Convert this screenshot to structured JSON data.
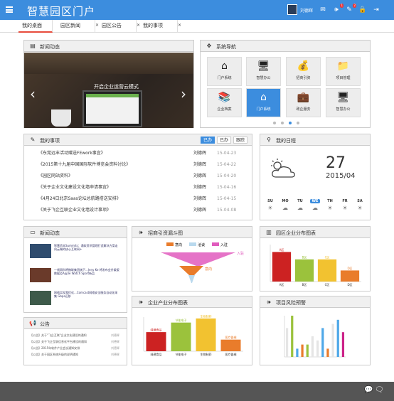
{
  "app": {
    "title": "智慧园区门户",
    "user": "刘德辉"
  },
  "tabs": [
    {
      "label": "我的桌面"
    },
    {
      "label": "园区新闻"
    },
    {
      "label": "园区公告"
    },
    {
      "label": "我的事项"
    }
  ],
  "news_panel": {
    "title": "新闻动态",
    "slide_caption": "开启企业运营云模式"
  },
  "nav_panel": {
    "title": "系统导航",
    "tiles": [
      {
        "label": "门户系统"
      },
      {
        "label": "智慧办公"
      },
      {
        "label": "招商引资"
      },
      {
        "label": "项目管理"
      },
      {
        "label": "企业档案"
      },
      {
        "label": "门户系统"
      },
      {
        "label": "政企服务"
      },
      {
        "label": "智慧办公"
      }
    ]
  },
  "todo_panel": {
    "title": "我的事项",
    "buttons": [
      "已办",
      "已办",
      "跟踪"
    ],
    "rows": [
      {
        "title": "《东莞远丰活动赠送FEwork事宜》",
        "who": "刘德辉",
        "date": "15-04-23"
      },
      {
        "title": "《2015第十九届中国国际软件博览会资料讨论》",
        "who": "刘德辉",
        "date": "15-04-22"
      },
      {
        "title": "《园区网站资料》",
        "who": "刘德辉",
        "date": "15-04-20"
      },
      {
        "title": "《关于企业文化建设文化墙申请事宜》",
        "who": "刘德辉",
        "date": "15-04-16"
      },
      {
        "title": "《4月24日北京Saas论坛总航路搭送安排》",
        "who": "刘德辉",
        "date": "15-04-15"
      },
      {
        "title": "《关于飞企互联企业文化墙设计事项》",
        "who": "刘德辉",
        "date": "15-04-08"
      }
    ]
  },
  "schedule_panel": {
    "title": "我的日程",
    "day": "27",
    "month": "2015/04",
    "week": [
      "SU",
      "MO",
      "TU",
      "WE",
      "TH",
      "FR",
      "SA"
    ]
  },
  "small_news": {
    "title": "新闻动态",
    "items": [
      {
        "text": "智慧资本Summits：通软资讯管理打造解决方案走向云端的核心互联网+"
      },
      {
        "text": "一线网科将携联集团旗下...Jeny Ke 将发布会升级版数据及Apple Watch Sport新品"
      },
      {
        "text": "网络实现我们化...Comcast网络安全服务自动化采集 Gbps迁移"
      }
    ]
  },
  "notice": {
    "title": "公告",
    "rows": [
      {
        "text": "【公告】关于\"飞企互联\"企业文化建设的通知",
        "date": "刘德辉"
      },
      {
        "text": "【公告】关于飞企互联信息化平台建设的通知",
        "date": "刘德辉"
      },
      {
        "text": "【公告】2015年软件产业会议通知安排",
        "date": "刘德辉"
      },
      {
        "text": "【公告】关于园区系统升级的说明通知",
        "date": "刘德辉"
      }
    ]
  },
  "funnel_panel": {
    "title": "招商引资漏斗图"
  },
  "enterprise_panel": {
    "title": "园区企业分布图表"
  },
  "industry_panel": {
    "title": "企业产业分布图表"
  },
  "risk_panel": {
    "title": "项目风险预警"
  },
  "colors": {
    "primary": "#3c8dde",
    "accent": "#e74c3c"
  },
  "chart_data": [
    {
      "type": "funnel",
      "series": [
        {
          "name": "意向",
          "value": 100
        },
        {
          "name": "洽谈",
          "value": 60
        },
        {
          "name": "入驻",
          "value": 20
        }
      ],
      "labels": [
        "入驻",
        "意向"
      ]
    },
    {
      "type": "bar",
      "categories": [
        "A区",
        "B区",
        "C区",
        "D区"
      ],
      "values": [
        4,
        3,
        3,
        1.5
      ],
      "data_labels": [
        "A区",
        "B区",
        "C区",
        "D区"
      ],
      "colors": [
        "#cc2222",
        "#9bc23c",
        "#f2c230",
        "#e97c2b"
      ],
      "ylim": [
        0,
        5
      ]
    },
    {
      "type": "bar",
      "categories": [
        "绿建食品",
        "节能电子",
        "生物制药",
        "医疗器械"
      ],
      "values": [
        2.8,
        4.2,
        4.8,
        1.7
      ],
      "data_labels": [
        "绿建食品",
        "节能电子",
        "生物制药",
        "医疗器械"
      ],
      "colors": [
        "#cc2222",
        "#9bc23c",
        "#f2c230",
        "#e97c2b"
      ],
      "ylim": [
        0,
        5
      ]
    },
    {
      "type": "bar",
      "categories": [
        "1",
        "2",
        "3",
        "4",
        "5",
        "6",
        "7",
        "8",
        "9",
        "10",
        "11",
        "12"
      ],
      "values": [
        7,
        10,
        2,
        3,
        3,
        5,
        4,
        7,
        2,
        8,
        9,
        6
      ],
      "colors": [
        "#e5e5e5",
        "#9bc23c",
        "#4fa8e8",
        "#e97c2b",
        "#9bc23c",
        "#e5e5e5",
        "#e5e5e5",
        "#4fa8e8",
        "#e97c2b",
        "#e5e5e5",
        "#4fa8e8",
        "#cc2288"
      ],
      "ylim": [
        0,
        10
      ]
    }
  ]
}
